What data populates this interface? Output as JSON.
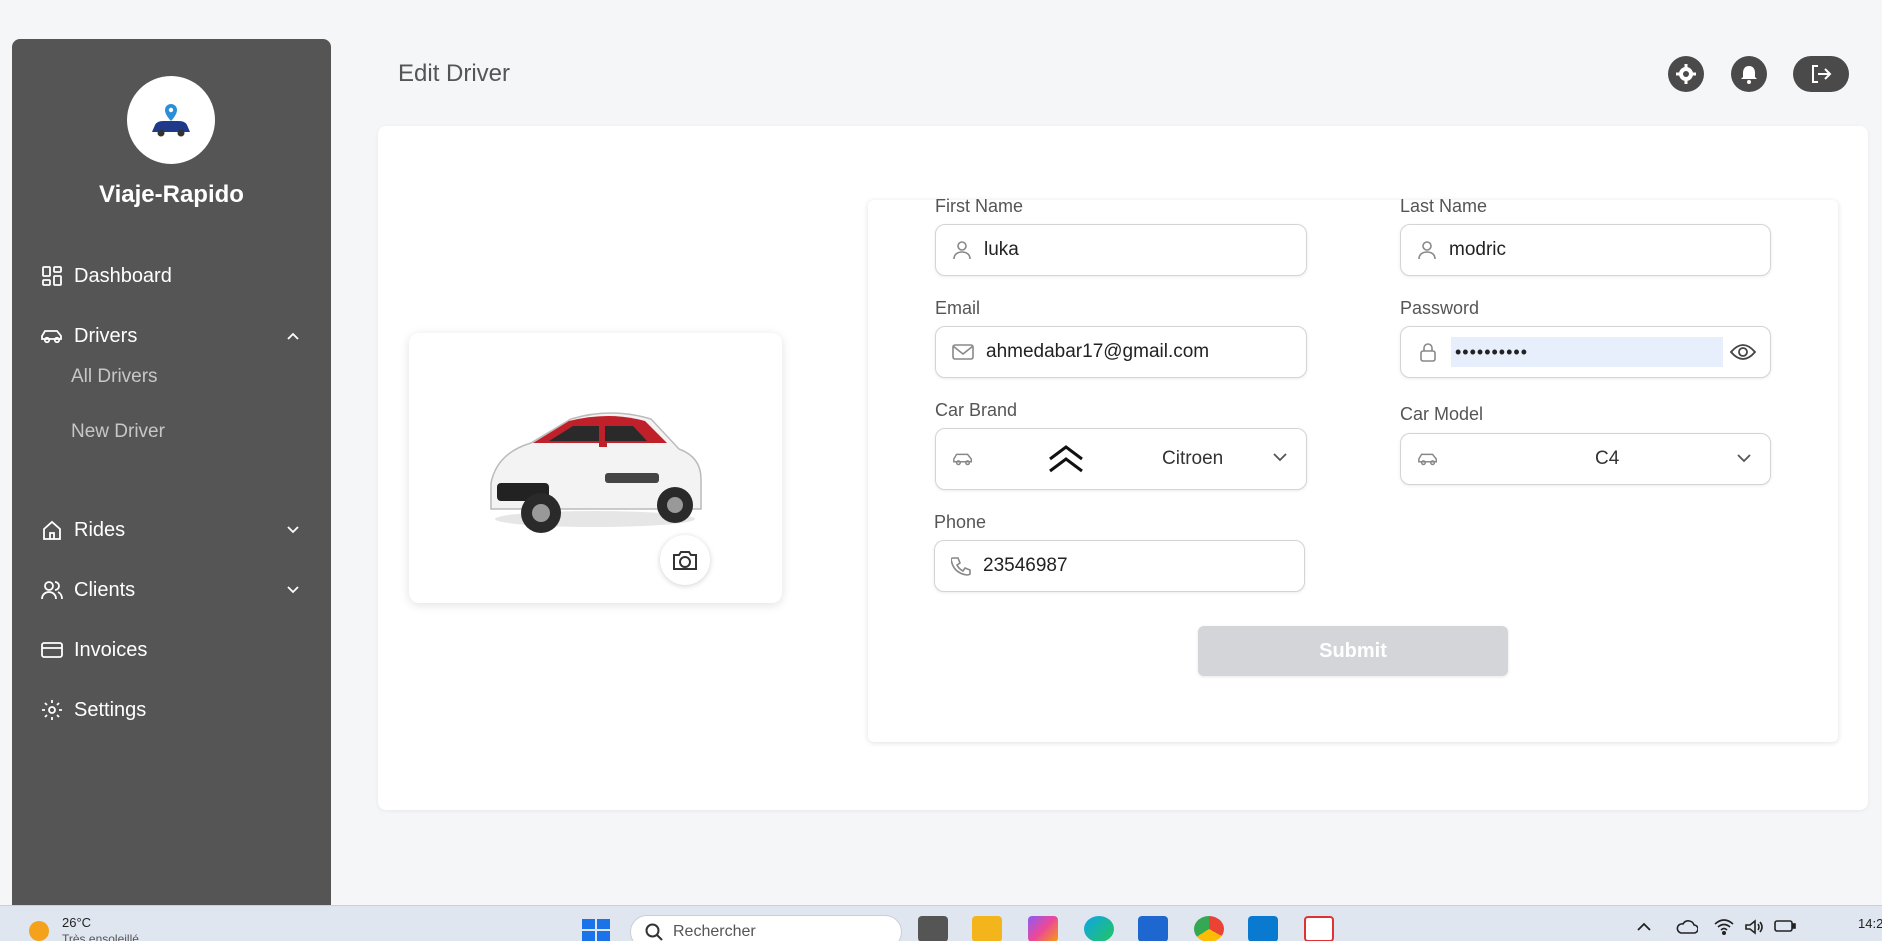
{
  "app": {
    "brand": "Viaje-Rapido"
  },
  "sidebar": {
    "items": [
      {
        "label": "Dashboard"
      },
      {
        "label": "Drivers"
      },
      {
        "label": "Rides"
      },
      {
        "label": "Clients"
      },
      {
        "label": "Invoices"
      },
      {
        "label": "Settings"
      }
    ],
    "sub_items": [
      {
        "label": "All Drivers"
      },
      {
        "label": "New Driver"
      }
    ]
  },
  "header": {
    "title": "Edit Driver"
  },
  "form": {
    "first_name": {
      "label": "First Name",
      "value": "luka"
    },
    "last_name": {
      "label": "Last Name",
      "value": "modric"
    },
    "email": {
      "label": "Email",
      "value": "ahmedabar17@gmail.com"
    },
    "password": {
      "label": "Password",
      "value": "••••••••••"
    },
    "car_brand": {
      "label": "Car Brand",
      "value": "Citroen"
    },
    "car_model": {
      "label": "Car Model",
      "value": "C4"
    },
    "phone": {
      "label": "Phone",
      "value": "23546987"
    },
    "submit_label": "Submit"
  },
  "taskbar": {
    "temperature": "26°C",
    "weather_text": "Très ensoleillé",
    "search_placeholder": "Rechercher",
    "time": "14:2"
  },
  "colors": {
    "sidebar_bg": "#555555",
    "submit_bg": "#d4d5d9",
    "page_bg": "#f5f6f8"
  }
}
